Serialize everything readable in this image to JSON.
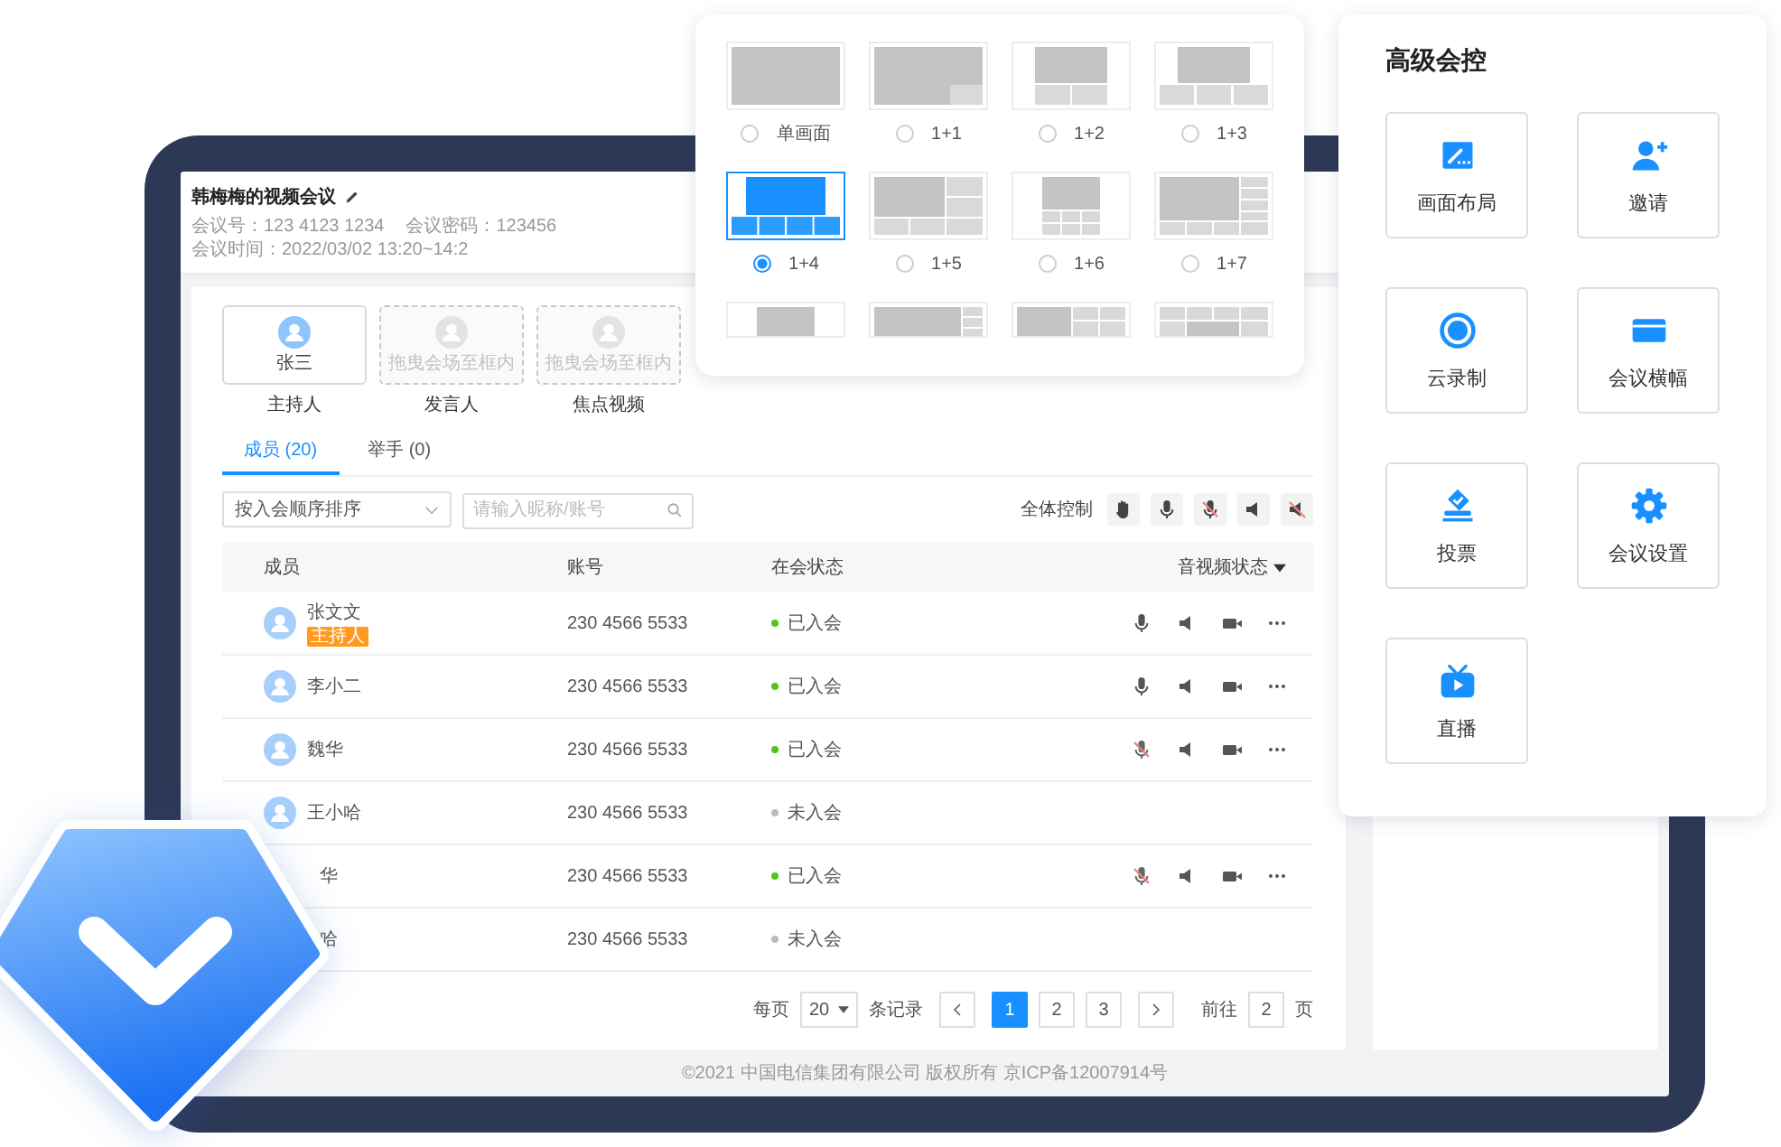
{
  "meeting": {
    "title": "韩梅梅的视频会议",
    "meta": [
      "会议号：123 4123 1234",
      "会议密码：123456",
      "会议时间：2022/03/02 13:20~14:2"
    ]
  },
  "roles": [
    {
      "text": "张三",
      "label": "主持人",
      "assigned": true
    },
    {
      "text": "拖曳会场至框内",
      "label": "发言人",
      "assigned": false
    },
    {
      "text": "拖曳会场至框内",
      "label": "焦点视频",
      "assigned": false
    }
  ],
  "tabs": [
    {
      "label": "成员 (20)",
      "selected": true
    },
    {
      "label": "举手 (0)",
      "selected": false
    }
  ],
  "sort_select": {
    "value": "按入会顺序排序"
  },
  "search": {
    "placeholder": "请输入昵称/账号"
  },
  "all_control": {
    "label": "全体控制"
  },
  "table": {
    "columns": [
      "成员",
      "账号",
      "在会状态",
      "音视频状态"
    ],
    "rows": [
      {
        "name": "张文文",
        "tag": "主持人",
        "avatar": true,
        "account": "230 4566 5533",
        "status": "已入会",
        "joined": true,
        "mic_muted": false
      },
      {
        "name": "李小二",
        "avatar": true,
        "account": "230 4566 5533",
        "status": "已入会",
        "joined": true,
        "mic_muted": false
      },
      {
        "name": "魏华",
        "avatar": true,
        "account": "230 4566 5533",
        "status": "已入会",
        "joined": true,
        "mic_muted": true
      },
      {
        "name": "王小哈",
        "avatar": true,
        "account": "230 4566 5533",
        "status": "未入会",
        "joined": false
      },
      {
        "name": "华",
        "avatar": false,
        "account": "230 4566 5533",
        "status": "已入会",
        "joined": true,
        "mic_muted": true
      },
      {
        "name": "哈",
        "avatar": false,
        "account": "230 4566 5533",
        "status": "未入会",
        "joined": false
      }
    ]
  },
  "pagination": {
    "per_page_label": "每页",
    "per_page": "20",
    "records_label": "条记录",
    "pages": [
      {
        "label": "1",
        "selected": true
      },
      {
        "label": "2",
        "selected": false
      },
      {
        "label": "3",
        "selected": false
      }
    ],
    "goto_label": "前往",
    "goto_value": "2",
    "page_unit": "页"
  },
  "footer": "©2021 中国电信集团有限公司 版权所有 京ICP备12007914号",
  "layouts": [
    {
      "kind": "single",
      "label": "单画面",
      "selected": false
    },
    {
      "kind": "pip",
      "label": "1+1",
      "selected": false
    },
    {
      "kind": "two",
      "label": "1+2",
      "selected": false
    },
    {
      "kind": "three",
      "label": "1+3",
      "selected": false
    },
    {
      "kind": "four",
      "label": "1+4",
      "selected": true
    },
    {
      "kind": "five",
      "label": "1+5",
      "selected": false
    },
    {
      "kind": "six",
      "label": "1+6",
      "selected": false
    },
    {
      "kind": "seven",
      "label": "1+7",
      "selected": false
    },
    {
      "kind": "top-center"
    },
    {
      "kind": "big-right"
    },
    {
      "kind": "left-grid"
    },
    {
      "kind": "grid"
    }
  ],
  "advanced": {
    "title": "高级会控",
    "items": [
      {
        "kind": "layout",
        "label": "画面布局"
      },
      {
        "kind": "invite",
        "label": "邀请"
      },
      {
        "kind": "record",
        "label": "云录制"
      },
      {
        "kind": "banner",
        "label": "会议横幅"
      },
      {
        "kind": "vote",
        "label": "投票"
      },
      {
        "kind": "settings",
        "label": "会议设置"
      },
      {
        "kind": "live",
        "label": "直播"
      }
    ]
  }
}
